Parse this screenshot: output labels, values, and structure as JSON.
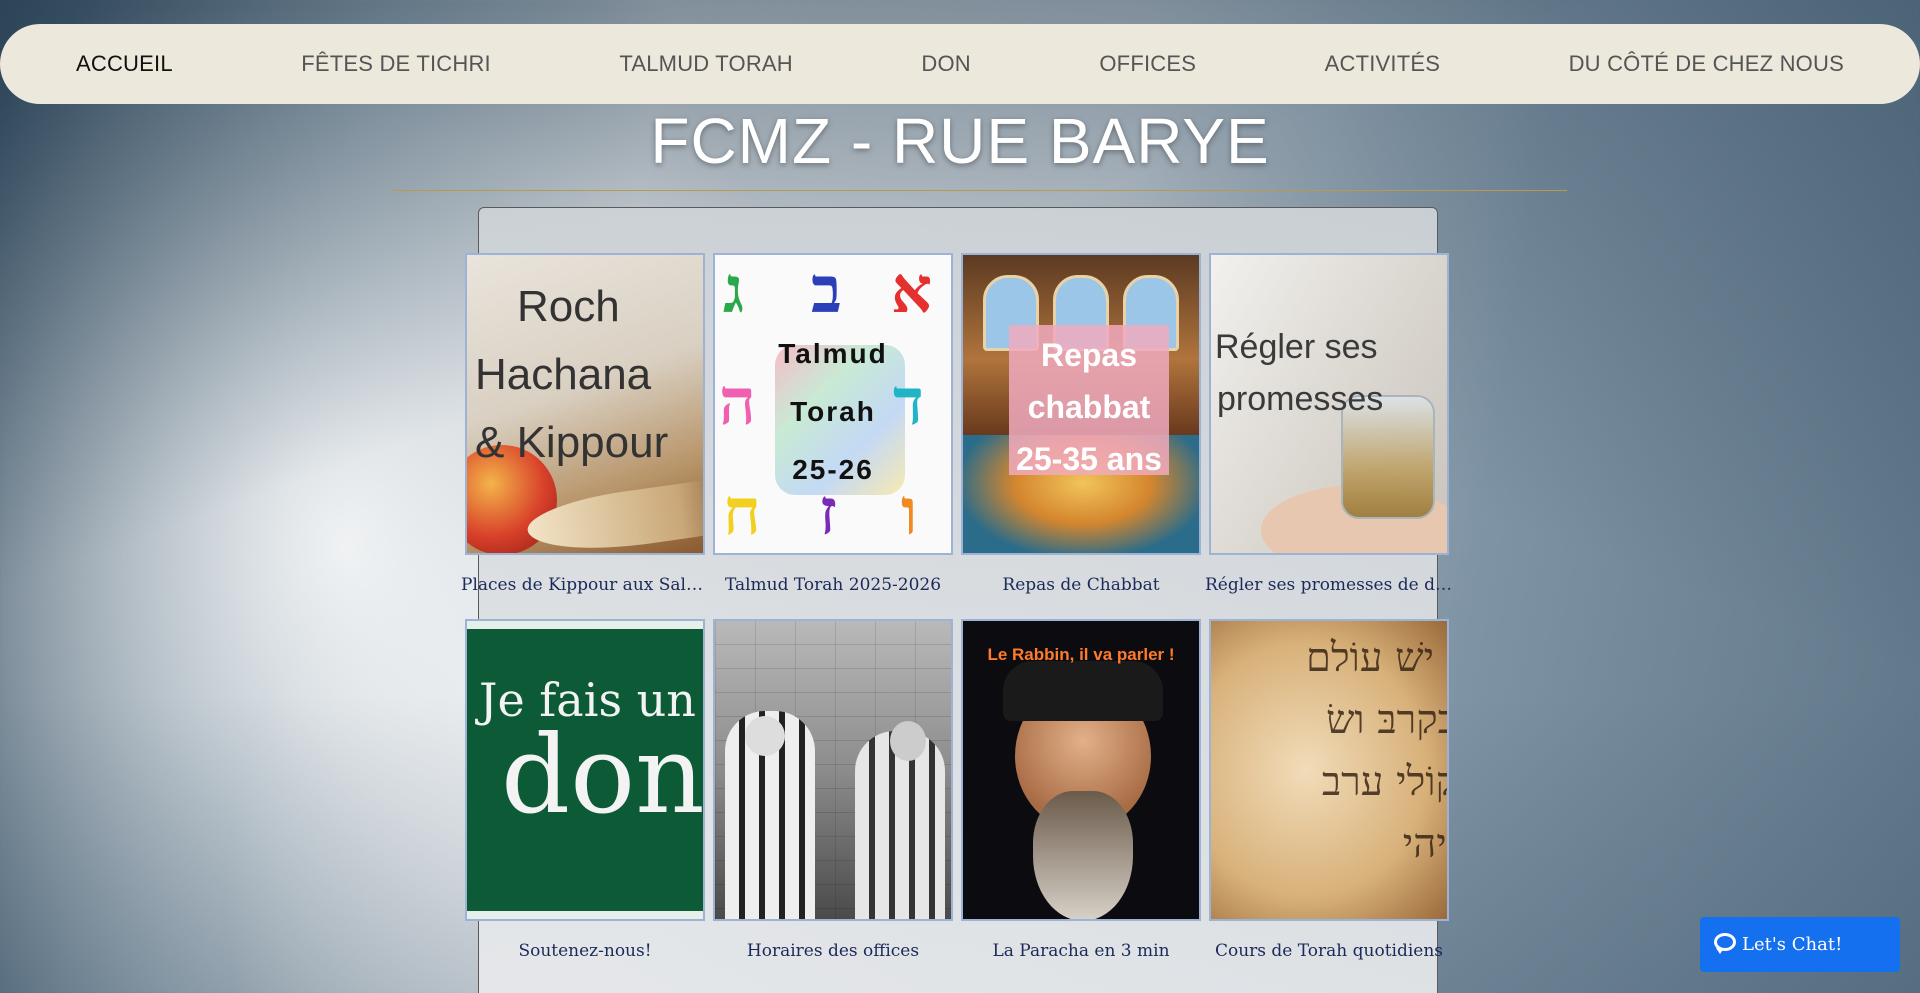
{
  "nav": {
    "items": [
      {
        "label": "ACCUEIL",
        "active": true
      },
      {
        "label": "FÊTES DE TICHRI",
        "active": false
      },
      {
        "label": "TALMUD TORAH",
        "active": false
      },
      {
        "label": "DON",
        "active": false
      },
      {
        "label": "OFFICES",
        "active": false
      },
      {
        "label": "ACTIVITÉS",
        "active": false
      },
      {
        "label": "DU CÔTÉ DE CHEZ NOUS",
        "active": false
      }
    ]
  },
  "site": {
    "title": "FCMZ - RUE BARYE"
  },
  "gallery": {
    "items": [
      {
        "caption": "Places de Kippour aux Salons Hoche",
        "image_text": [
          "Roch",
          "Hachana",
          "& Kippour"
        ]
      },
      {
        "caption": "Talmud Torah 2025-2026",
        "image_text": [
          "Talmud",
          "Torah",
          "25-26"
        ],
        "letters": [
          "ג",
          "ב",
          "א",
          "ה",
          "ד",
          "ח",
          "ז",
          "ו"
        ]
      },
      {
        "caption": "Repas de Chabbat",
        "image_text": [
          "Repas",
          "chabbat",
          "25-35 ans"
        ]
      },
      {
        "caption": "Régler ses promesses de don",
        "image_text": [
          "Régler ses",
          "promesses"
        ]
      },
      {
        "caption": "Soutenez-nous!",
        "image_text": [
          "Je fais un",
          "don"
        ]
      },
      {
        "caption": "Horaires des offices",
        "image_text": []
      },
      {
        "caption": "La Paracha en 3 min",
        "image_text": [
          "Le Rabbin, il va parler !"
        ]
      },
      {
        "caption": "Cours de Torah quotidiens",
        "image_text": [
          "ו ישׁ עוֹלם",
          "בקרבּ ושׂ",
          "קוֹלי ערב",
          "ויהי"
        ]
      }
    ]
  },
  "chat": {
    "label": "Let's Chat!"
  },
  "colors": {
    "nav_bg": "#ede8dc",
    "caption_text": "#1b2a58",
    "title_rule": "#b89a4e",
    "chat_button": "#1570ef"
  },
  "icons": [
    "chat-bubble-icon"
  ]
}
